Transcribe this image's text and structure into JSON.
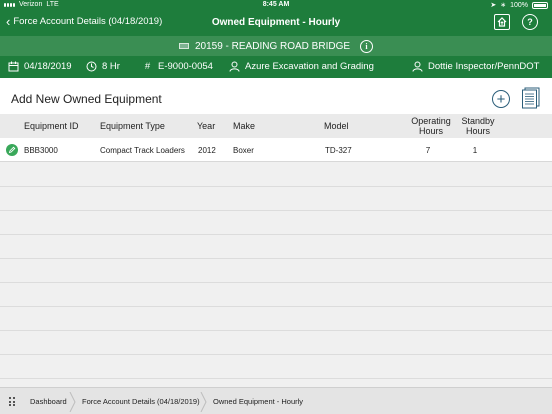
{
  "status_bar": {
    "carrier": "Verizon",
    "network": "LTE",
    "time": "8:45 AM",
    "battery": "100%"
  },
  "navbar": {
    "back_label": "Force Account Details (04/18/2019)",
    "title": "Owned Equipment - Hourly"
  },
  "project": {
    "label": "20159 - READING ROAD BRIDGE"
  },
  "info": {
    "date": "04/18/2019",
    "hours": "8 Hr",
    "number": "E-9000-0054",
    "company": "Azure Excavation and Grading",
    "inspector": "Dottie Inspector/PennDOT"
  },
  "section": {
    "title": "Add New Owned Equipment"
  },
  "table": {
    "headers": {
      "equipment_id": "Equipment ID",
      "equipment_type": "Equipment Type",
      "year": "Year",
      "make": "Make",
      "model": "Model",
      "operating_hours_1": "Operating",
      "operating_hours_2": "Hours",
      "standby_hours_1": "Standby",
      "standby_hours_2": "Hours"
    },
    "rows": [
      {
        "equipment_id": "BBB3000",
        "equipment_type": "Compact Track Loaders",
        "year": "2012",
        "make": "Boxer",
        "model": "TD-327",
        "operating_hours": "7",
        "standby_hours": "1"
      }
    ]
  },
  "breadcrumb": {
    "items": [
      "Dashboard",
      "Force Account Details (04/18/2019)",
      "Owned Equipment - Hourly"
    ]
  },
  "colors": {
    "header_green": "#1e7d3c",
    "project_green": "#3a8e53",
    "accent_blue": "#2b5e7a",
    "edit_green": "#39a85a"
  }
}
